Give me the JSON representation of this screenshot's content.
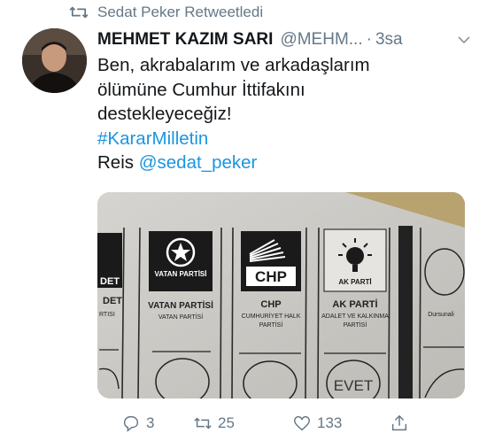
{
  "retweet_banner": {
    "icon": "retweet-icon",
    "text": "Sedat Peker Retweetledi"
  },
  "tweet": {
    "author_name": "MEHMET KAZIM SARI",
    "handle": "@MEHM...",
    "separator": "·",
    "time": "3sa",
    "text_lines": [
      "Ben, akrabalarım ve arkadaşlarım",
      "ölümüne Cumhur İttifakını",
      "destekleyeceğiz!"
    ],
    "hashtag": "#KararMilletin",
    "reis_prefix": "Reis",
    "mention": "@sedat_peker"
  },
  "ballot": {
    "col1_short": "DET",
    "col1_top": "DET",
    "col1_sub": "RTISI",
    "vatan_logo": "VATAN PARTİSİ",
    "vatan_name": "VATAN PARTİSİ",
    "vatan_sub": "VATAN PARTİSİ",
    "chp_logo": "CHP",
    "chp_name": "CHP",
    "chp_sub1": "CUMHURİYET HALK",
    "chp_sub2": "PARTİSİ",
    "akp_logo_text": "AK PARTİ",
    "akp_name": "AK PARTİ",
    "akp_sub1": "ADALET VE KALKINMA",
    "akp_sub2": "PARTİSİ",
    "evet_stamp": "EVET",
    "last_col": "Dursunali"
  },
  "actions": {
    "replies": "3",
    "retweets": "25",
    "likes": "133"
  },
  "colors": {
    "link": "#1b95e0",
    "muted": "#657786",
    "text": "#14171a"
  }
}
